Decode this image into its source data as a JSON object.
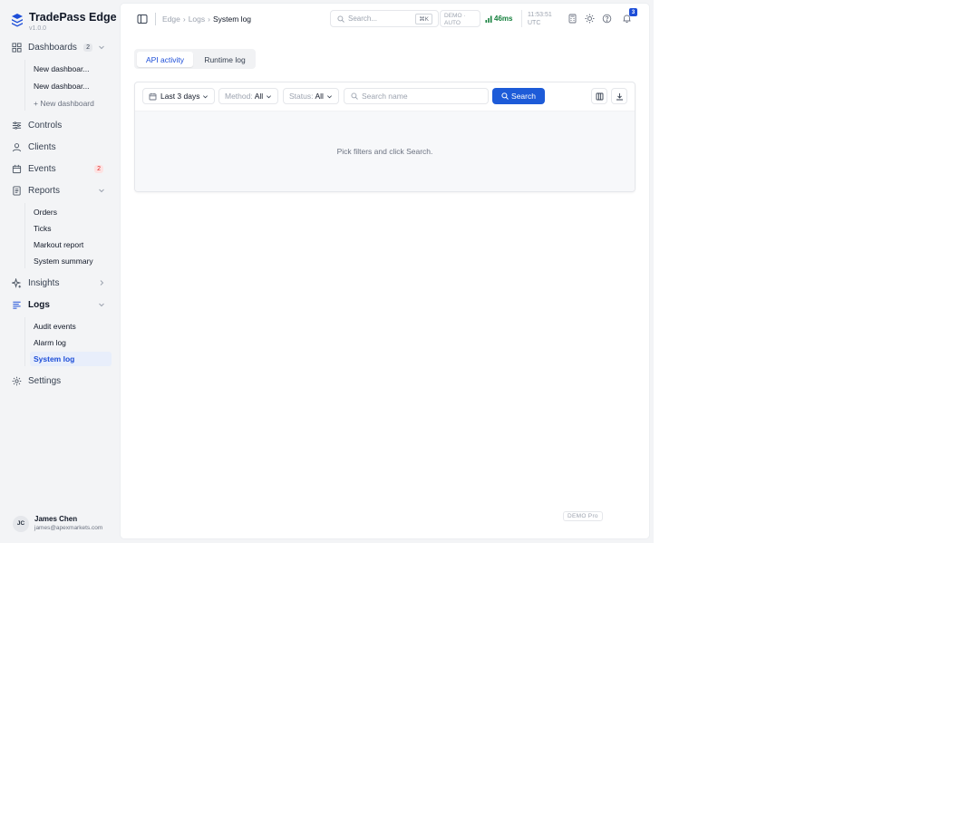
{
  "brand": {
    "name": "TradePass Edge",
    "version": "v1.0.0",
    "accent": "#1d4ed8"
  },
  "sidebar": {
    "dashboards": {
      "label": "Dashboards",
      "badge": "2"
    },
    "dashboard_items": [
      "New dashboar...",
      "New dashboar...",
      "+ New dashboard"
    ],
    "controls": {
      "label": "Controls"
    },
    "clients": {
      "label": "Clients"
    },
    "events": {
      "label": "Events",
      "badge": "2"
    },
    "reports": {
      "label": "Reports"
    },
    "report_items": [
      "Orders",
      "Ticks",
      "Markout report",
      "System summary"
    ],
    "insights": {
      "label": "Insights"
    },
    "logs": {
      "label": "Logs"
    },
    "log_items": [
      "Audit events",
      "Alarm log",
      "System log"
    ],
    "settings": {
      "label": "Settings"
    }
  },
  "user": {
    "initials": "JC",
    "name": "James Chen",
    "email": "james@apexmarkets.com"
  },
  "topbar": {
    "breadcrumb": [
      "Edge",
      "Logs",
      "System log"
    ],
    "search_placeholder": "Search...",
    "search_shortcut": "⌘K",
    "mode_line1": "DEMO ·",
    "mode_line2": "AUTO",
    "latency": "46ms",
    "time": "11:53:51",
    "timezone": "UTC",
    "notifications": "3"
  },
  "tabs": [
    {
      "label": "API activity",
      "active": true
    },
    {
      "label": "Runtime log",
      "active": false
    }
  ],
  "filters": {
    "range": "Last 3 days",
    "method_label": "Method:",
    "method_value": "All",
    "status_label": "Status:",
    "status_value": "All",
    "name_placeholder": "Search name",
    "search_button": "Search"
  },
  "empty_message": "Pick filters and click Search.",
  "plan_badge": "DEMO Pro"
}
